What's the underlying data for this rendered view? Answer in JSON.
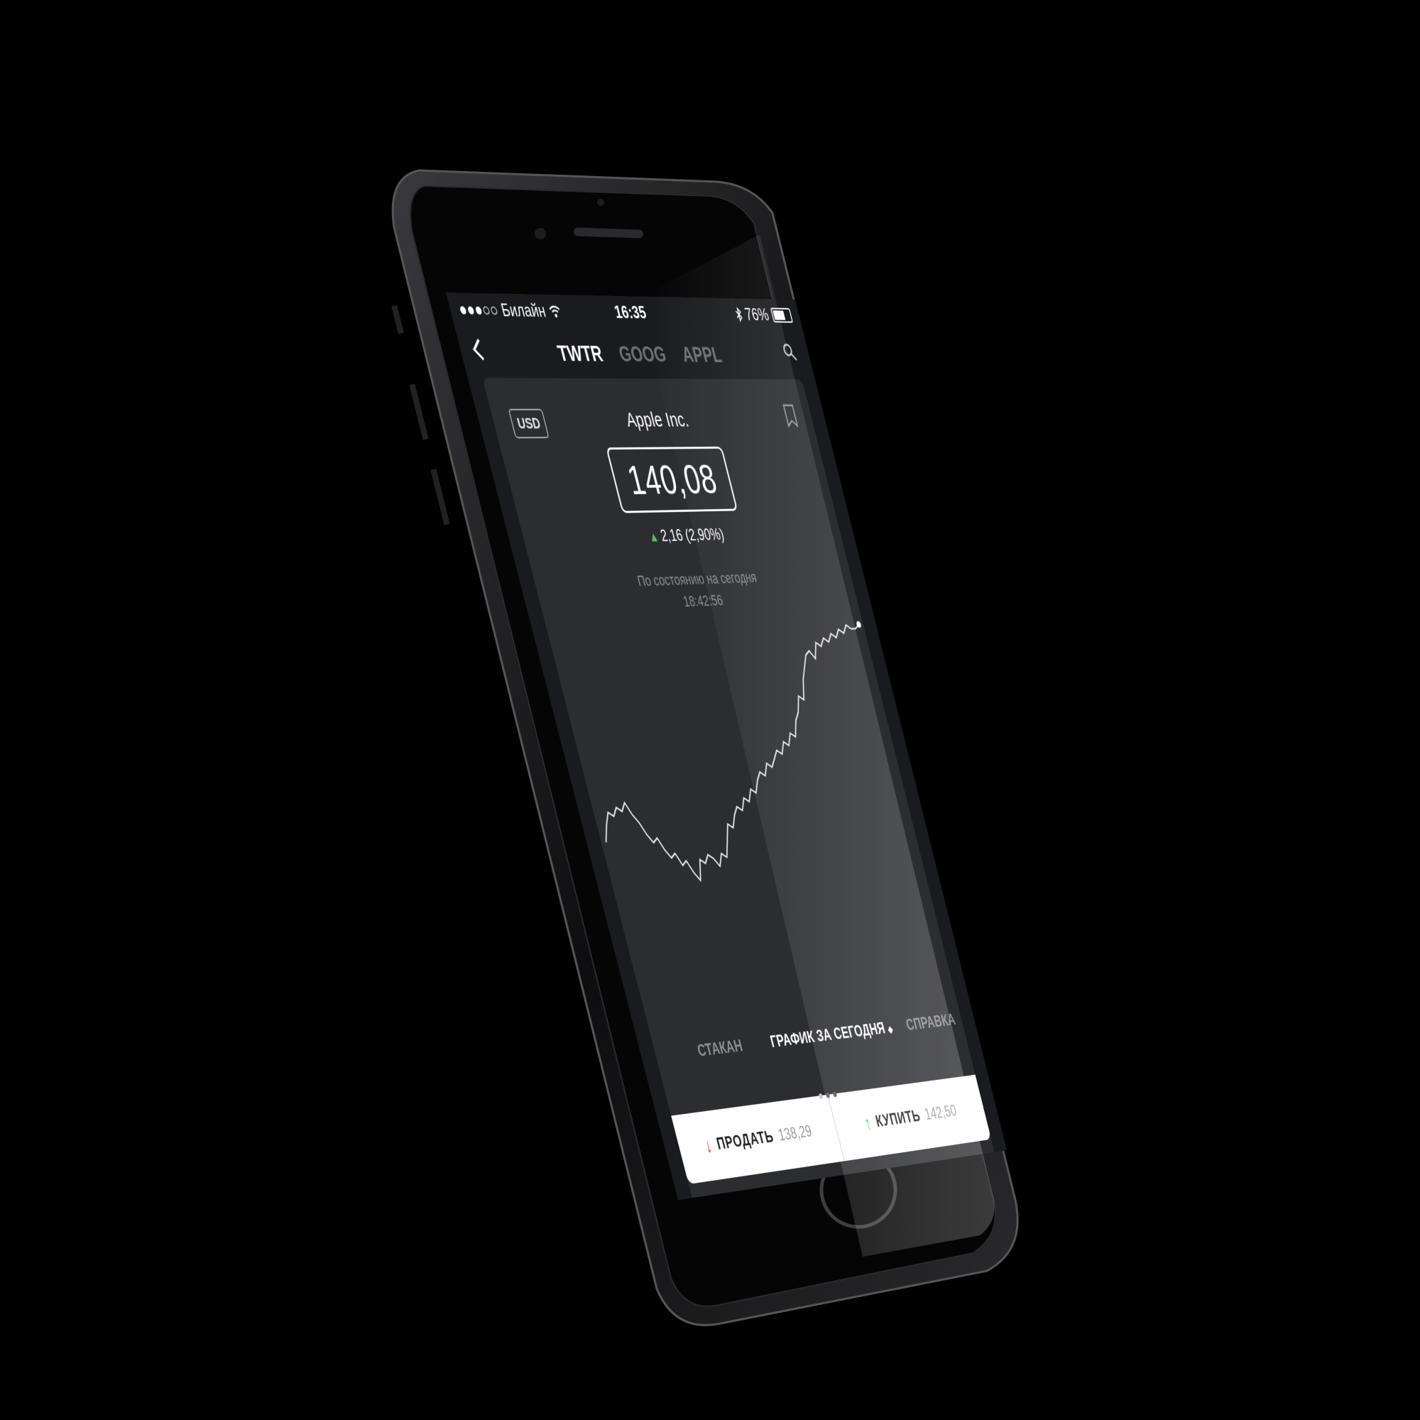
{
  "status_bar": {
    "signal": "●●●○○",
    "carrier": "Билайн",
    "time": "16:35",
    "battery": "76%",
    "battery_level": 0.76
  },
  "nav": {
    "tabs": [
      "TWTR",
      "GOOG",
      "APPL"
    ],
    "active_tab": "TWTR"
  },
  "stock": {
    "currency": "USD",
    "company": "Apple Inc.",
    "price": "140,08",
    "change": "2,16 (2,90%)",
    "asof_line1": "По состоянию на сегодня",
    "asof_line2": "18:42:56"
  },
  "chart_data": {
    "type": "line",
    "x": [
      0,
      1,
      2,
      3,
      4,
      5,
      6,
      7,
      8,
      9,
      10,
      11,
      12,
      13,
      14,
      15,
      16,
      17,
      18,
      19,
      20,
      21,
      22,
      23,
      24,
      25,
      26,
      27,
      28,
      29,
      30,
      31,
      32,
      33,
      34,
      35,
      36,
      37,
      38,
      39,
      40,
      41,
      42,
      43,
      44,
      45,
      46,
      47,
      48,
      49,
      50,
      51,
      52,
      53,
      54,
      55,
      56,
      57,
      58,
      59,
      60,
      61,
      62,
      63,
      64,
      65,
      66,
      67,
      68,
      69,
      70,
      71,
      72,
      73,
      74,
      75,
      76,
      77,
      78,
      79
    ],
    "values": [
      40,
      44,
      47,
      46,
      48,
      47,
      49,
      46,
      44,
      41,
      39,
      40,
      37,
      35,
      36,
      33,
      34,
      31,
      29,
      34,
      33,
      35,
      34,
      32,
      35,
      34,
      38,
      42,
      41,
      44,
      46,
      45,
      48,
      47,
      50,
      49,
      52,
      54,
      53,
      56,
      55,
      57,
      59,
      58,
      61,
      60,
      63,
      62,
      66,
      68,
      72,
      71,
      76,
      79,
      82,
      83,
      81,
      85,
      84,
      86,
      85,
      87,
      86,
      88,
      87,
      89,
      88,
      88,
      89
    ],
    "series_color": "#e9e9ec"
  },
  "bottom_tabs": {
    "left": "СТАКАН",
    "center": "ГРАФИК ЗА СЕГОДНЯ",
    "center_suffix": "◆",
    "right": "СПРАВКА"
  },
  "trade": {
    "sell_label": "ПРОДАТЬ",
    "sell_price": "138,29",
    "buy_label": "КУПИТЬ",
    "buy_price": "142,50"
  },
  "colors": {
    "up": "#5cc25a",
    "down": "#e0453b",
    "background": "#1a1b1e",
    "card": "#2c2d31"
  },
  "icons": [
    "back-arrow-icon",
    "search-icon",
    "bookmark-icon",
    "wifi-icon",
    "bluetooth-icon",
    "battery-icon"
  ]
}
